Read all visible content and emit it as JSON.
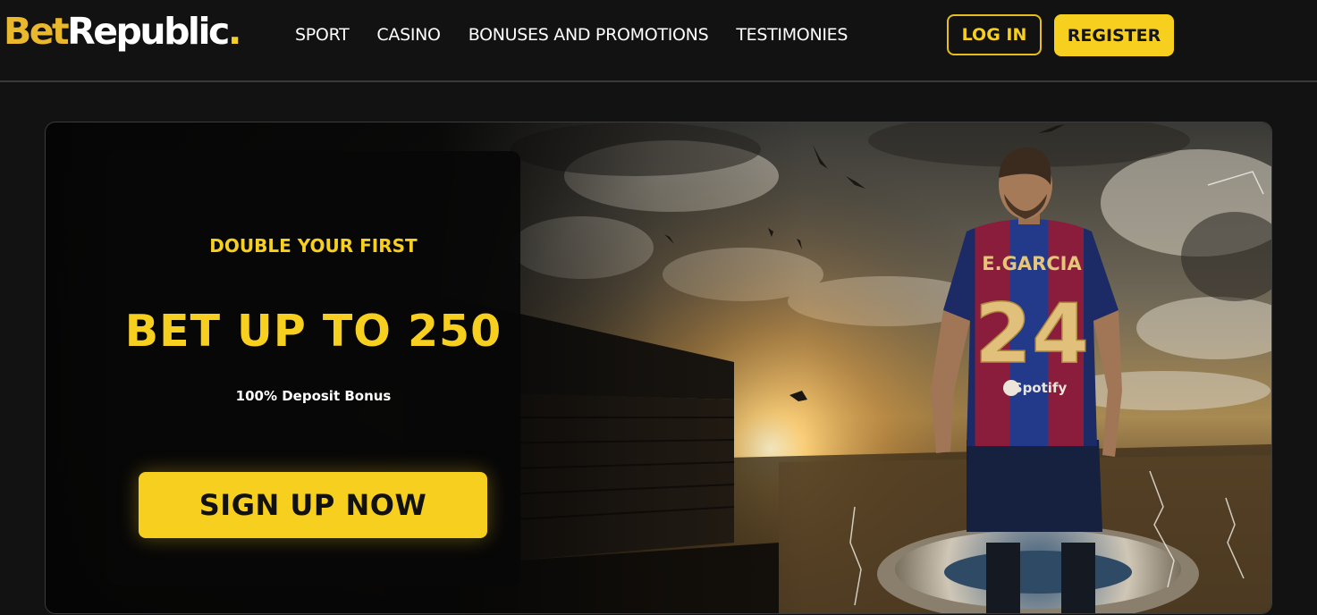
{
  "brand": {
    "logo_part1": "Bet",
    "logo_part2": "Republic",
    "logo_dot": "."
  },
  "nav": {
    "items": [
      {
        "label": "SPORT"
      },
      {
        "label": "CASINO"
      },
      {
        "label": "BONUSES AND PROMOTIONS"
      },
      {
        "label": "TESTIMONIES"
      }
    ]
  },
  "auth": {
    "login_label": "LOG IN",
    "register_label": "REGISTER"
  },
  "hero": {
    "pre_title": "DOUBLE YOUR FIRST",
    "title": "BET UP TO 250",
    "subtitle": "100% Deposit Bonus",
    "cta_label": "SIGN UP NOW",
    "jersey_name": "E.GARCIA",
    "jersey_number": "24",
    "jersey_sponsor": "Spotify"
  },
  "colors": {
    "accent": "#f7cf1f",
    "logo_gold": "#e9b82c",
    "background": "#121212",
    "text": "#ffffff"
  }
}
